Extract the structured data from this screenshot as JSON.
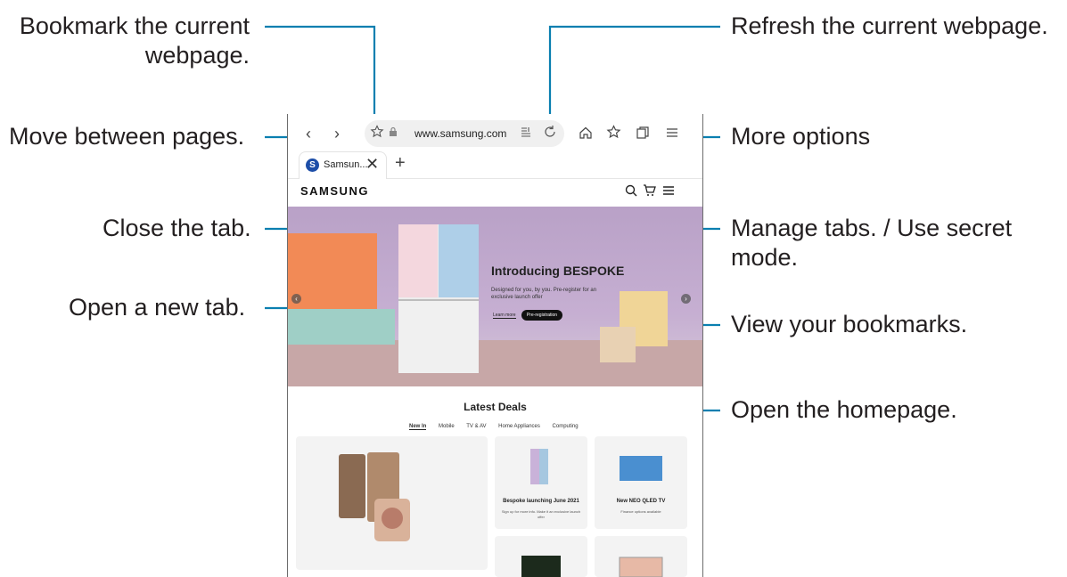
{
  "callouts": {
    "bookmark": "Bookmark the current\nwebpage.",
    "bookmark_line1": "Bookmark the current",
    "bookmark_line2": "webpage.",
    "move_pages": "Move between pages.",
    "close_tab": "Close the tab.",
    "new_tab": "Open a new tab.",
    "refresh": "Refresh the current webpage.",
    "more_options": "More options",
    "manage_tabs_line1": "Manage tabs. / Use secret",
    "manage_tabs_line2": "mode.",
    "view_bookmarks": "View your bookmarks.",
    "homepage": "Open the homepage."
  },
  "browser": {
    "back_glyph": "‹",
    "forward_glyph": "›",
    "url": "www.samsung.com",
    "tab_label": "Samsun...",
    "tab_favicon": "S",
    "close_glyph": "✕",
    "new_tab_glyph": "+"
  },
  "site": {
    "logo": "SAMSUNG",
    "hero_title": "Introducing BESPOKE",
    "hero_sub": "Designed for you, by you. Pre-register for an exclusive launch offer",
    "hero_learn": "Learn more",
    "hero_prereg": "Pre-registration",
    "section_title": "Latest Deals",
    "deal_tabs": [
      "New In",
      "Mobile",
      "TV & AV",
      "Home Appliances",
      "Computing"
    ],
    "card1_title": "Bespoke launching June 2021",
    "card1_sub": "Sign up for more info. Make it an exclusive launch offer",
    "card2_title": "New NEO QLED TV",
    "card2_sub": "Finance options available"
  },
  "icons": [
    "star-icon",
    "lock-icon",
    "reader-icon",
    "refresh-icon",
    "home-icon",
    "bookmarks-icon",
    "tabs-icon",
    "menu-icon",
    "search-icon",
    "cart-icon"
  ],
  "colors": {
    "leader": "#0a7fb0",
    "text": "#231f20"
  }
}
